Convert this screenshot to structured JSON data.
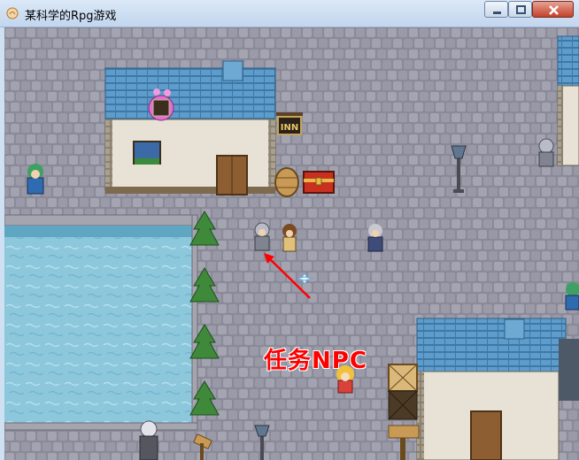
{
  "window": {
    "title": "某科学的Rpg游戏",
    "controls": {
      "minimize": "minimize",
      "maximize": "maximize",
      "close": "close"
    }
  },
  "map": {
    "annotation": "任务NPC",
    "annotation_color": "#ff0000",
    "inn_sign": "INN"
  },
  "colors": {
    "cobblestone": "#8a8a98",
    "roof": "#4f8fbf",
    "wall": "#e8e2d6",
    "water": "#8cc7dc"
  }
}
